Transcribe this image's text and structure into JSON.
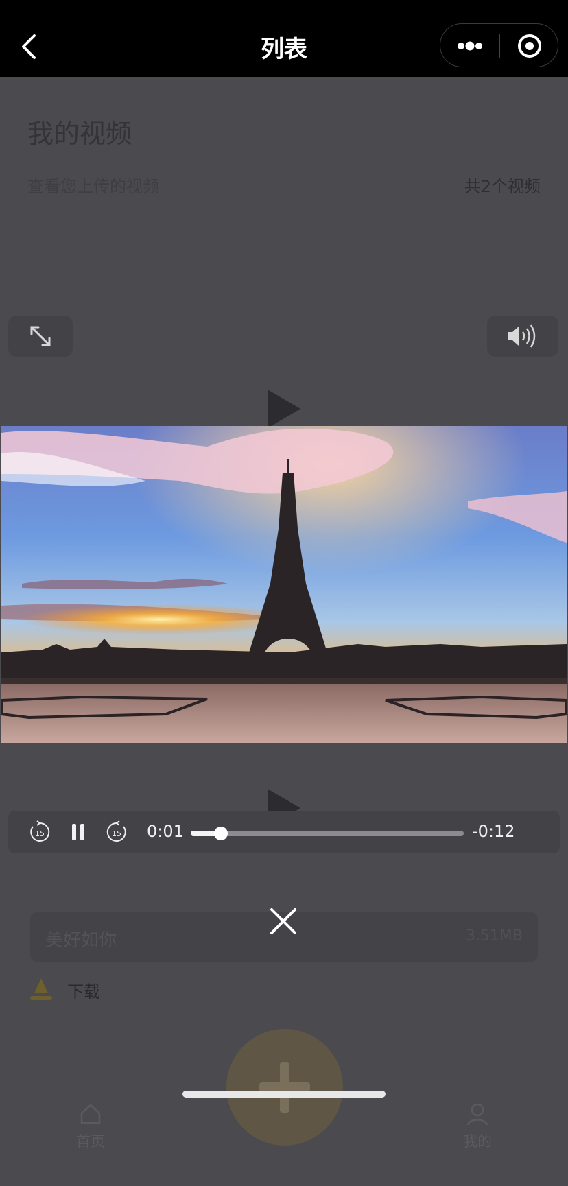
{
  "nav": {
    "title": "列表",
    "back_icon": "chevron-left-icon",
    "more_icon": "more-dots-icon",
    "close_icon": "target-circle-icon"
  },
  "page": {
    "heading": "我的视频",
    "subtitle": "查看您上传的视频",
    "count": "共2个视频"
  },
  "video_controls": {
    "fullscreen_icon": "expand-arrows-icon",
    "volume_icon": "speaker-volume-icon",
    "rewind_icon": "rewind-15-icon",
    "rewind_label": "15",
    "pause_icon": "pause-icon",
    "forward_icon": "forward-15-icon",
    "forward_label": "15",
    "current_time": "0:01",
    "remaining_time": "-0:12",
    "progress": 0.11,
    "close_icon": "close-x-icon"
  },
  "file": {
    "name": "美好如你",
    "size": "3.51MB"
  },
  "download": {
    "label": "下载",
    "icon": "download-icon"
  },
  "add_button": {
    "icon": "plus-icon"
  },
  "tabbar": {
    "home_label": "首页",
    "home_icon": "home-icon",
    "profile_label": "我的",
    "profile_icon": "person-icon"
  },
  "colors": {
    "overlay_bg": "#4a4a4f",
    "nav_bg": "#000000",
    "accent_dimmed": "#5f5645"
  }
}
